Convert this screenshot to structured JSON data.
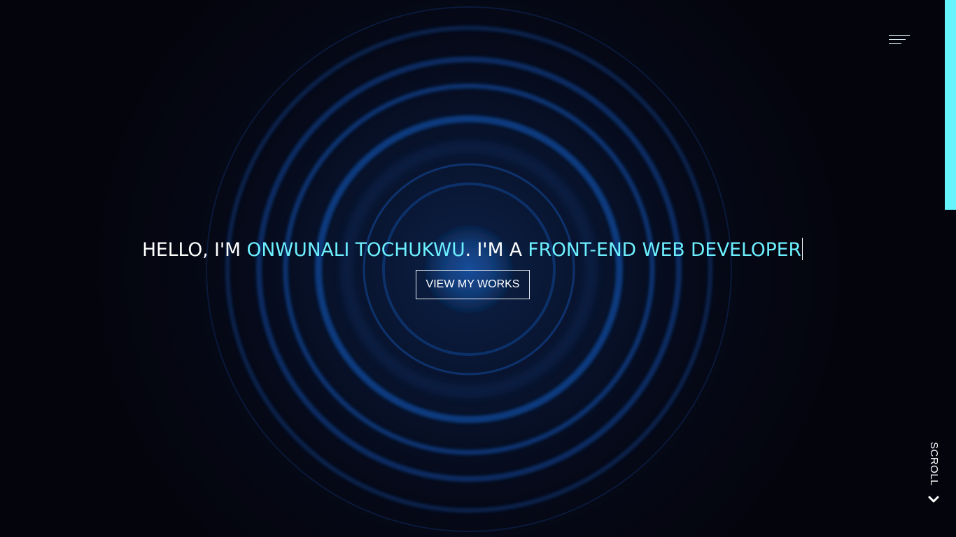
{
  "hero": {
    "headline": {
      "prefix": "HELLO, I'M ",
      "name": "ONWUNALI TOCHUKWU",
      "middle": ". I'M A ",
      "role": "FRONT-END WEB DEVELOPER"
    },
    "cta_label": "VIEW MY WORKS",
    "scroll_label": "SCROLL"
  },
  "icons": {
    "menu": "hamburger-menu-icon",
    "scroll": "chevron-down-icon"
  },
  "colors": {
    "background": "#05050f",
    "accent": "#6df0ff",
    "scroll_bar": "#66f4ff",
    "ring": "#0d3f8a",
    "text": "#ffffff"
  },
  "page_scroll_progress": 0.39
}
